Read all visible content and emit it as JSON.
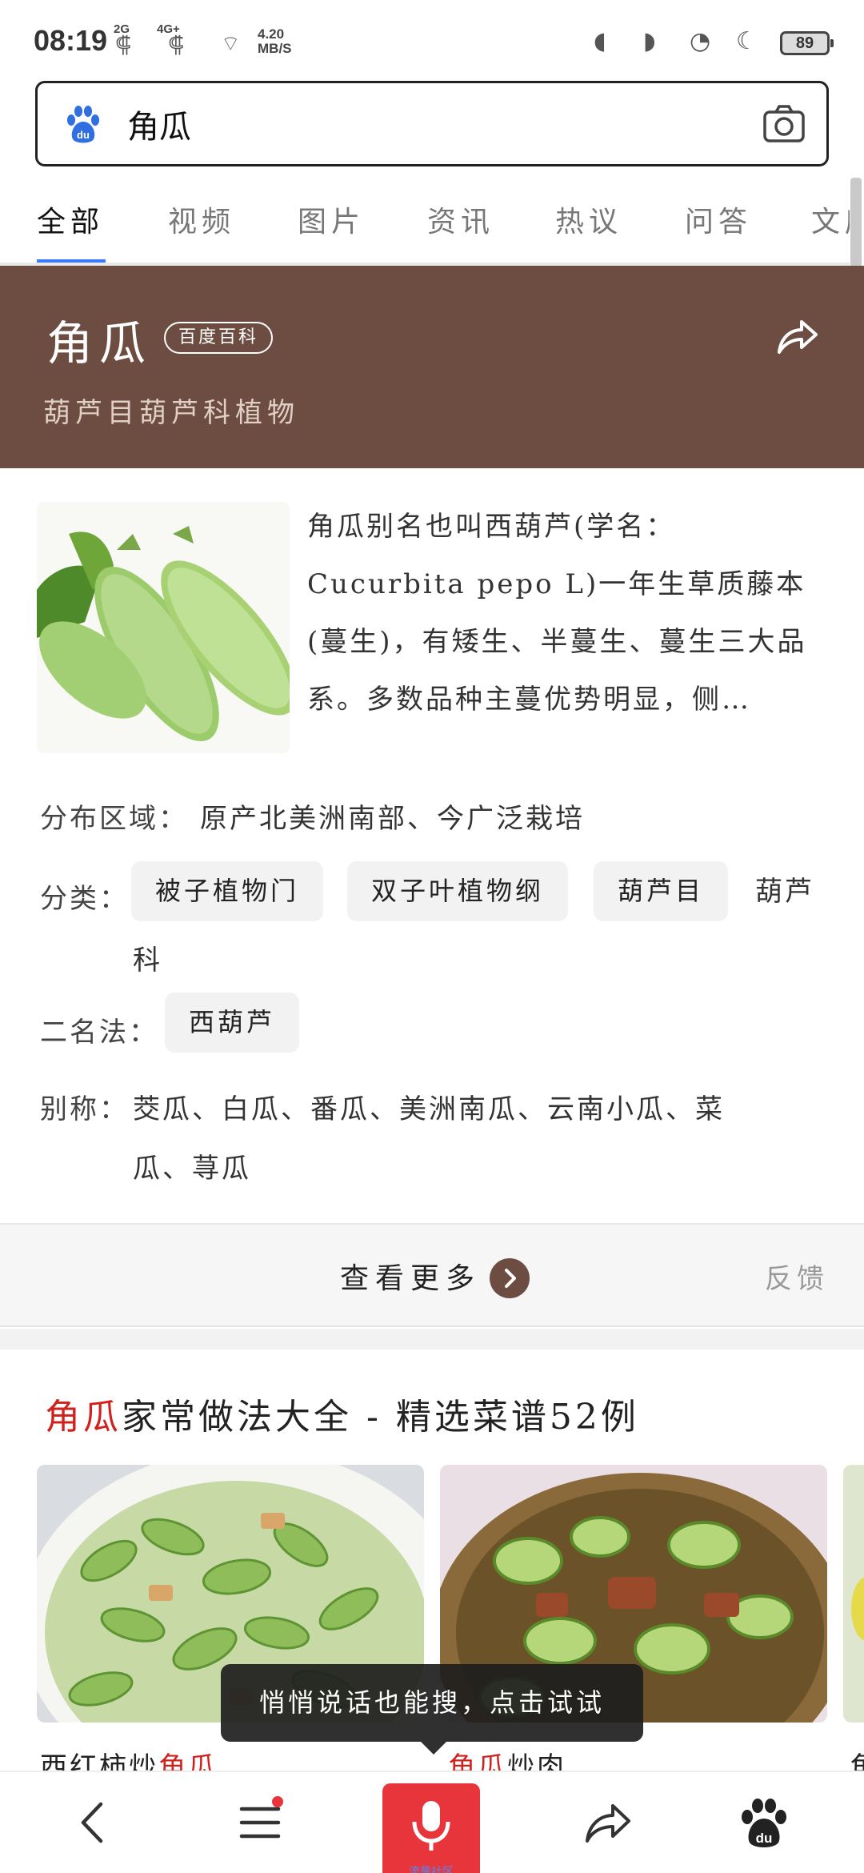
{
  "status_bar": {
    "time": "08:19",
    "net1": "2G",
    "net2": "4G+",
    "speed_value": "4.20",
    "speed_unit": "MB/S",
    "battery": "89"
  },
  "search": {
    "query": "角瓜"
  },
  "tabs": [
    "全部",
    "视频",
    "图片",
    "资讯",
    "热议",
    "问答",
    "文库"
  ],
  "hero": {
    "title": "角瓜",
    "badge": "百度百科",
    "subtitle": "葫芦目葫芦科植物"
  },
  "intro": {
    "text": "角瓜别名也叫西葫芦(学名：Cucurbita pepo L)一年生草质藤本(蔓生)，有矮生、半蔓生、蔓生三大品系。多数品种主蔓优势明显，侧…"
  },
  "info": {
    "distribution_label": "分布区域：",
    "distribution_value": "原产北美洲南部、今广泛栽培",
    "classification_label": "分类：",
    "classification_chips": [
      "被子植物门",
      "双子叶植物纲",
      "葫芦目"
    ],
    "classification_tail1": "葫芦",
    "classification_tail2": "科",
    "binomial_label": "二名法：",
    "binomial_chip": "西葫芦",
    "alias_label": "别称：",
    "alias_line1": "茭瓜、白瓜、番瓜、美洲南瓜、云南小瓜、菜",
    "alias_line2": "瓜、荨瓜"
  },
  "more": {
    "label": "查看更多",
    "feedback": "反馈"
  },
  "recipes": {
    "title_highlight": "角瓜",
    "title_rest": "家常做法大全 - 精选菜谱52例",
    "items": [
      {
        "pre": "西红柿炒",
        "hl": "角瓜",
        "post": ""
      },
      {
        "pre": "",
        "hl": "角瓜",
        "post": "炒肉"
      }
    ],
    "third_caption_hl": "角"
  },
  "tooltip": {
    "text": "悄悄说话也能搜，点击试试"
  },
  "bottom_nav": {
    "mic_label": "流量社区"
  },
  "colors": {
    "hero_bg": "#6d4c41",
    "highlight": "#d0211c",
    "tab_underline": "#3a7bff",
    "mic_button": "#e8343b"
  }
}
